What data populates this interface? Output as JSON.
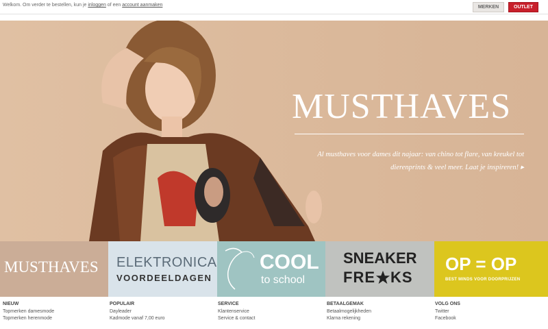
{
  "topbar": {
    "welcome_prefix": "Welkom. Om verder te bestellen, kun je",
    "login_link": "inloggen",
    "welcome_middle": "of een",
    "account_link": "account aanmaken",
    "buttons": {
      "merken": "MERKEN",
      "outlet": "OUTLET"
    }
  },
  "hero": {
    "title": "MUSTHAVES",
    "text": "Al musthaves voor dames dit najaar: van chino tot flare, van kreukel tot dierenprints & veel meer.",
    "cta": "Laat je inspireren!",
    "cta_arrow": "▸",
    "background": "#dbb99b"
  },
  "tiles": {
    "musthaves": "MUSTHAVES",
    "elektronica": {
      "line1": "ELEKTRONICA",
      "line2": "VOORDEELDAGEN"
    },
    "cool": {
      "line1": "COOL",
      "line2": "to school"
    },
    "sneaker": {
      "line1": "SNEAKER",
      "line2a": "FRE",
      "line2b": "KS"
    },
    "opop": {
      "line1": "OP = OP",
      "line2": "BEST MINDS VOOR DOORPRIJZEN"
    }
  },
  "footer": [
    {
      "heading": "NIEUW",
      "links": [
        "Topmerken damesmode",
        "Topmerken herenmode"
      ]
    },
    {
      "heading": "POPULAIR",
      "links": [
        "Dayleader",
        "Kadmode vanaf 7,00 euro"
      ]
    },
    {
      "heading": "SERVICE",
      "links": [
        "Klantenservice",
        "Service & contact"
      ]
    },
    {
      "heading": "BETAALGEMAK",
      "links": [
        "Betaalmogelijkheden",
        "Klarna rekening"
      ]
    },
    {
      "heading": "VOLG ONS",
      "links": [
        "Twitter",
        "Facebook"
      ]
    }
  ],
  "colors": {
    "outlet": "#c8202b",
    "tile_musthaves": "#cbad97",
    "tile_elektronica": "#d9e3ea",
    "tile_cool": "#9fc4c2",
    "tile_sneaker": "#c0c2bf",
    "tile_opop": "#dcc61e"
  }
}
